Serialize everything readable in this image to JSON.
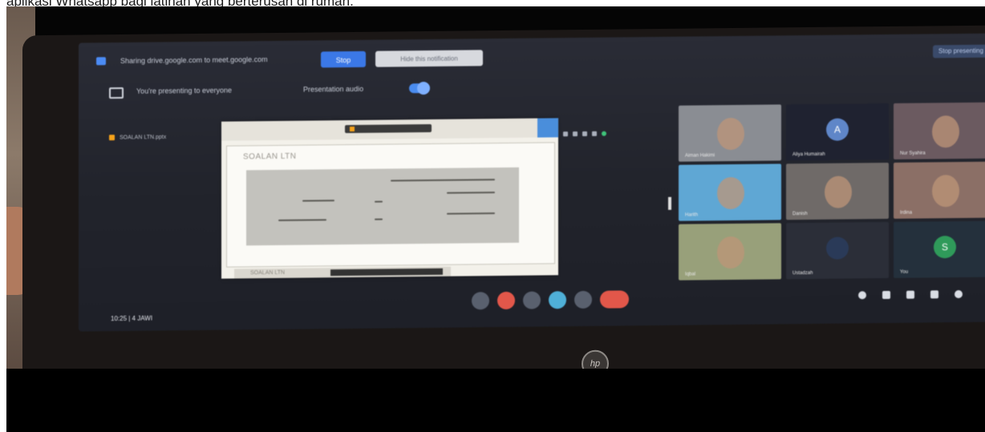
{
  "caption": "aplikasi Whatsapp bagi latihan yang berterusan di rumah.",
  "meet": {
    "share_text": "Sharing drive.google.com to meet.google.com",
    "stop_label": "Stop",
    "hide_label": "Hide this notification",
    "presenting_text": "You're presenting to everyone",
    "audio_text": "Presentation audio",
    "top_right_chip": "Stop presenting",
    "tab_label": "SOALAN LTN.pptx",
    "time_label": "10:25  |  4 JAWI",
    "participants": [
      {
        "name": "Aiman Hakimi",
        "type": "video",
        "color": "#8a8d93"
      },
      {
        "name": "Aliya Humairah",
        "type": "avatar",
        "color": "#1f2230",
        "avatar_color": "#5f86c8",
        "initial": "A"
      },
      {
        "name": "Nur Syahira",
        "type": "video",
        "color": "#6b5a60"
      },
      {
        "name": "Harith",
        "type": "video",
        "color": "#5fa7d4"
      },
      {
        "name": "Danish",
        "type": "video",
        "color": "#6f6a68"
      },
      {
        "name": "Irdina",
        "type": "video",
        "color": "#8b6f66"
      },
      {
        "name": "Iqbal",
        "type": "video",
        "color": "#98a07a"
      },
      {
        "name": "Ustadzah",
        "type": "avatar",
        "color": "#2b2e38",
        "avatar_color": "#2a3a58",
        "initial": ""
      },
      {
        "name": "You",
        "type": "avatar",
        "color": "#24303c",
        "avatar_color": "#2f9a5a",
        "initial": "S"
      }
    ]
  },
  "slide": {
    "title": "SOALAN LTN",
    "footer": "SOALAN LTN"
  },
  "brand": {
    "logo": "hp"
  }
}
